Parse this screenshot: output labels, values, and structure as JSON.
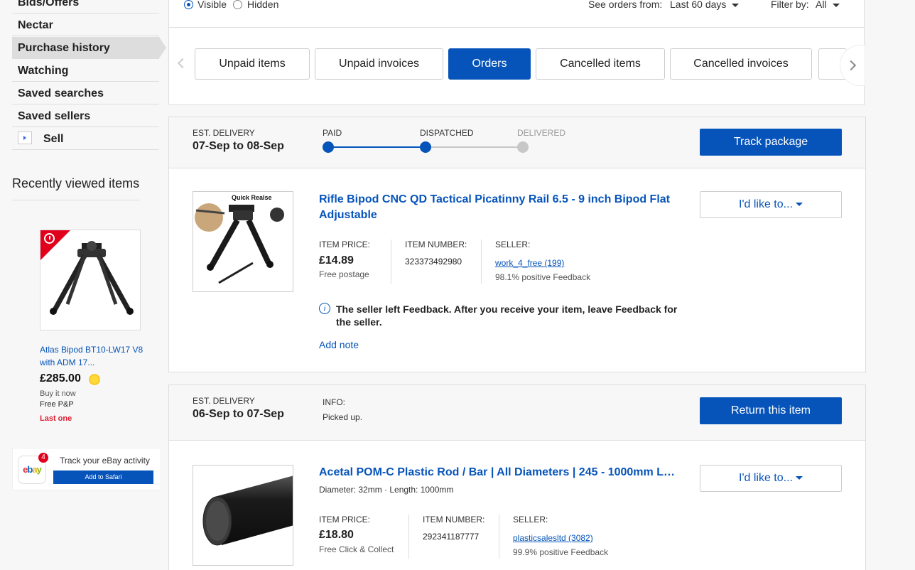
{
  "sidebar": {
    "items": [
      {
        "label": "Bids/Offers"
      },
      {
        "label": "Nectar"
      },
      {
        "label": "Purchase history"
      },
      {
        "label": "Watching"
      },
      {
        "label": "Saved searches"
      },
      {
        "label": "Saved sellers"
      },
      {
        "label": "Sell"
      }
    ],
    "recently_viewed": {
      "title": "Recently viewed items",
      "item": {
        "name": "Atlas Bipod BT10-LW17 V8 with ADM 17...",
        "price": "£285.00",
        "buy_type": "Buy it now",
        "shipping": "Free P&P",
        "stock": "Last one"
      }
    },
    "tracker": {
      "logo": {
        "e": "e",
        "b": "b",
        "a": "a",
        "y": "y"
      },
      "badge": "4",
      "text": "Track your eBay activity",
      "button": "Add to Safari"
    }
  },
  "filters": {
    "visible": "Visible",
    "hidden": "Hidden",
    "see_orders_label": "See orders from:",
    "see_orders_value": "Last 60 days",
    "filter_label": "Filter by:",
    "filter_value": "All"
  },
  "tabs": [
    {
      "label": "Unpaid items"
    },
    {
      "label": "Unpaid invoices"
    },
    {
      "label": "Orders"
    },
    {
      "label": "Cancelled items"
    },
    {
      "label": "Cancelled invoices"
    }
  ],
  "orders": [
    {
      "est_label": "EST. DELIVERY",
      "est_date": "07-Sep to 08-Sep",
      "progress": {
        "paid": "PAID",
        "dispatched": "DISPATCHED",
        "delivered": "DELIVERED"
      },
      "action": "Track package",
      "menu": "I'd like to...",
      "title": "Rifle Bipod CNC QD Tactical Picatinny Rail 6.5 - 9 inch Bipod Flat Adjustable",
      "thumb_text": "Quick Realse",
      "price_label": "ITEM PRICE:",
      "price": "£14.89",
      "shipping": "Free postage",
      "number_label": "ITEM NUMBER:",
      "number": "323373492980",
      "seller_label": "SELLER:",
      "seller": "work_4_free (199)",
      "feedback": "98.1% positive Feedback",
      "notice": "The seller left Feedback. After you receive your item, leave Feedback for the seller.",
      "add_note": "Add note"
    },
    {
      "est_label": "EST. DELIVERY",
      "est_date": "06-Sep to 07-Sep",
      "info_label": "INFO:",
      "info": "Picked up.",
      "action": "Return this item",
      "menu": "I'd like to...",
      "title": "Acetal POM-C Plastic Rod / Bar | All Diameters | 245 - 1000mm Le...",
      "variation": "Diameter: 32mm · Length: 1000mm",
      "price_label": "ITEM PRICE:",
      "price": "£18.80",
      "shipping": "Free Click & Collect",
      "number_label": "ITEM NUMBER:",
      "number": "292341187777",
      "seller_label": "SELLER:",
      "seller": "plasticsalesltd (3082)",
      "feedback": "99.9% positive Feedback"
    }
  ],
  "colors": {
    "accent": "#0654ba",
    "progress_done": "#0654ba",
    "progress_todo": "#c7c7c7",
    "alert": "#dd1e31"
  }
}
